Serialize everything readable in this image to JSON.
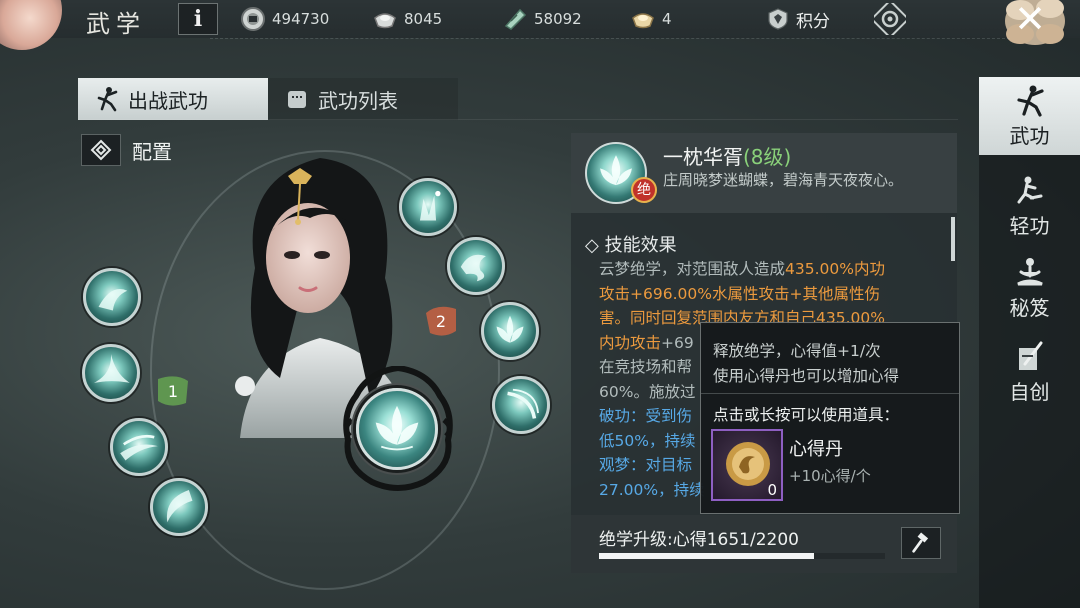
{
  "header": {
    "title": "武学",
    "info_label": "i",
    "currencies": [
      {
        "icon": "silver-coin-icon",
        "value": "494730"
      },
      {
        "icon": "silver-ingot-icon",
        "value": "8045"
      },
      {
        "icon": "jade-tablet-icon",
        "value": "58092"
      },
      {
        "icon": "gold-ingot-icon",
        "value": "4"
      }
    ],
    "score_label": "积分",
    "close_label": "✕"
  },
  "tabs": [
    {
      "label": "出战武功",
      "active": true,
      "icon": "martial-pose-icon"
    },
    {
      "label": "武功列表",
      "active": false,
      "icon": "scroll-list-icon"
    }
  ],
  "config": {
    "label": "配置"
  },
  "slots": {
    "slot1": "1",
    "slot2": "2"
  },
  "skill_detail": {
    "name": "一枕华胥",
    "level": "(8级)",
    "badge": "绝",
    "description": "庄周晓梦迷蝴蝶，碧海青天夜夜心。",
    "effect_title": "技能效果",
    "effect_lines": [
      {
        "parts": [
          {
            "t": "云梦绝学，对范围敌人造成",
            "c": ""
          },
          {
            "t": "435.00%内功",
            "c": "hl-orange"
          }
        ]
      },
      {
        "parts": [
          {
            "t": "攻击+696.00%水属性攻击+其他属性伤",
            "c": "hl-orange"
          }
        ]
      },
      {
        "parts": [
          {
            "t": "害。同时回复范围内友方和自己435.00%",
            "c": "hl-orange"
          }
        ]
      },
      {
        "parts": [
          {
            "t": "内功攻击",
            "c": "hl-orange"
          },
          {
            "t": "+69",
            "c": ""
          }
        ]
      },
      {
        "parts": [
          {
            "t": "在竞技场和帮",
            "c": ""
          }
        ]
      },
      {
        "parts": [
          {
            "t": "60%。施放过",
            "c": ""
          }
        ]
      },
      {
        "parts": [
          {
            "t": "破功：受到伤",
            "c": "hl-blue"
          }
        ]
      },
      {
        "parts": [
          {
            "t": "低50%，持续",
            "c": "hl-blue"
          }
        ]
      },
      {
        "parts": [
          {
            "t": "观梦：对目标",
            "c": "hl-blue"
          }
        ]
      },
      {
        "parts": [
          {
            "t": "27.00%，持续",
            "c": "hl-blue"
          }
        ]
      }
    ],
    "upgrade_label": "绝学升级:心得1651/2200",
    "upgrade_progress": 0.75
  },
  "tooltip": {
    "line1": "释放绝学，心得值+1/次",
    "line2": "使用心得丹也可以增加心得",
    "hint": "点击或长按可以使用道具：",
    "item_name": "心得丹",
    "item_desc": "+10心得/个",
    "item_count": "0"
  },
  "right_nav": [
    {
      "label": "武功",
      "active": true,
      "icon": "martial-pose-icon"
    },
    {
      "label": "轻功",
      "active": false,
      "icon": "running-figure-icon"
    },
    {
      "label": "秘笈",
      "active": false,
      "icon": "meditation-icon"
    },
    {
      "label": "自创",
      "active": false,
      "icon": "sword-scroll-icon"
    }
  ]
}
